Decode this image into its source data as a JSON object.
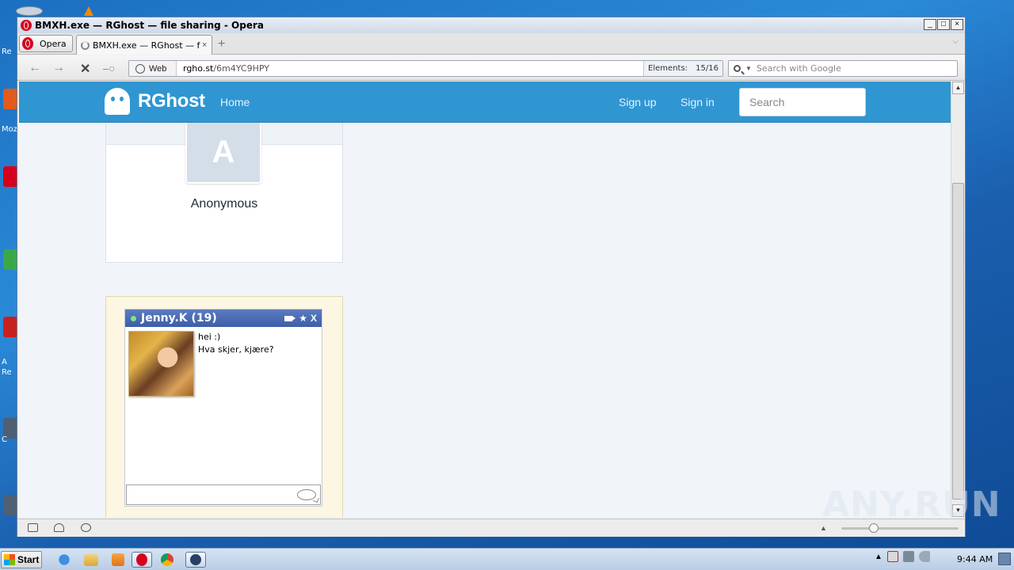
{
  "window": {
    "title": "BMXH.exe — RGhost — file sharing - Opera",
    "controls": [
      "_",
      "□",
      "×"
    ]
  },
  "browser": {
    "menu_label": "Opera",
    "tab_title": "BMXH.exe — RGhost — f…",
    "tab_close": "×",
    "new_tab": "+",
    "web_label": "Web",
    "url_host": "rgho.st",
    "url_path": "/6m4YC9HPY",
    "elements_label": "Elements:",
    "elements_value": "15/16",
    "search_placeholder": "Search with Google",
    "nav_icons": [
      "back-arrow-icon",
      "forward-arrow-icon",
      "stop-icon",
      "key-icon"
    ]
  },
  "site": {
    "brand": "RGhost",
    "nav_home": "Home",
    "sign_up": "Sign up",
    "sign_in": "Sign in",
    "search_placeholder": "Search",
    "accent_color": "#2f96d2"
  },
  "profile": {
    "avatar_letter": "A",
    "name": "Anonymous"
  },
  "chat_ad": {
    "name": "Jenny.K (19)",
    "status_color": "#7de87a",
    "messages": [
      "hei :)",
      "Hva skjer, kjære?"
    ],
    "header_icons": [
      "video-icon",
      "star-icon",
      "close-icon"
    ],
    "close_glyph": "X",
    "star_glyph": "★"
  },
  "taskbar": {
    "start_label": "Start",
    "clock": "9:44 AM",
    "apps": [
      "internet-explorer-icon",
      "explorer-folder-icon",
      "media-player-icon",
      "opera-icon",
      "chrome-icon",
      "app-icon"
    ]
  },
  "desktop": {
    "labels": [
      "Re",
      "Moz",
      "A",
      "Re",
      "C"
    ]
  },
  "watermark": "ANY.RUN"
}
